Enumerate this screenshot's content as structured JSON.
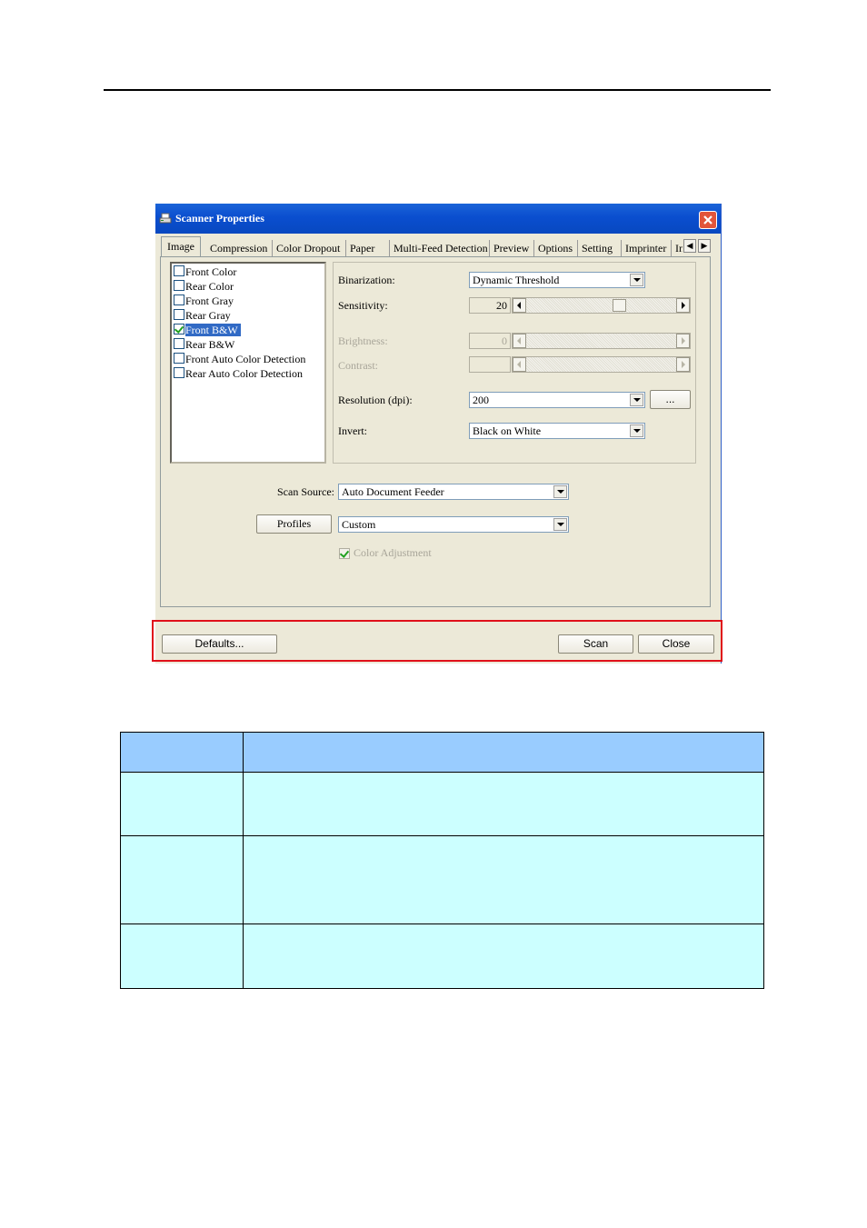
{
  "window": {
    "title": "Scanner Properties",
    "tabs": [
      "Image",
      "Compression",
      "Color Dropout",
      "Paper",
      "Multi-Feed Detection",
      "Preview",
      "Options",
      "Setting",
      "Imprinter",
      "In"
    ],
    "active_tab": "Image"
  },
  "image_list": [
    {
      "label": "Front Color",
      "checked": false,
      "selected": false
    },
    {
      "label": "Rear Color",
      "checked": false,
      "selected": false
    },
    {
      "label": "Front Gray",
      "checked": false,
      "selected": false
    },
    {
      "label": "Rear Gray",
      "checked": false,
      "selected": false
    },
    {
      "label": "Front B&W",
      "checked": true,
      "selected": true
    },
    {
      "label": "Rear B&W",
      "checked": false,
      "selected": false
    },
    {
      "label": "Front Auto Color Detection",
      "checked": false,
      "selected": false
    },
    {
      "label": "Rear Auto Color Detection",
      "checked": false,
      "selected": false
    }
  ],
  "settings": {
    "binarization_label": "Binarization:",
    "binarization_value": "Dynamic Threshold",
    "sensitivity_label": "Sensitivity:",
    "sensitivity_value": "20",
    "brightness_label": "Brightness:",
    "brightness_value": "0",
    "contrast_label": "Contrast:",
    "contrast_value": "",
    "resolution_label": "Resolution (dpi):",
    "resolution_value": "200",
    "resolution_more": "...",
    "invert_label": "Invert:",
    "invert_value": "Black on White"
  },
  "scan": {
    "source_label": "Scan Source:",
    "source_value": "Auto Document Feeder",
    "profiles_button": "Profiles",
    "profile_value": "Custom",
    "color_adjustment_label": "Color Adjustment",
    "color_adjustment_checked": true
  },
  "buttons": {
    "defaults": "Defaults...",
    "scan": "Scan",
    "close": "Close"
  },
  "colors": {
    "highlight_box": "#e0101a",
    "table_header": "#99ccff",
    "table_rows": "#ccffff"
  }
}
